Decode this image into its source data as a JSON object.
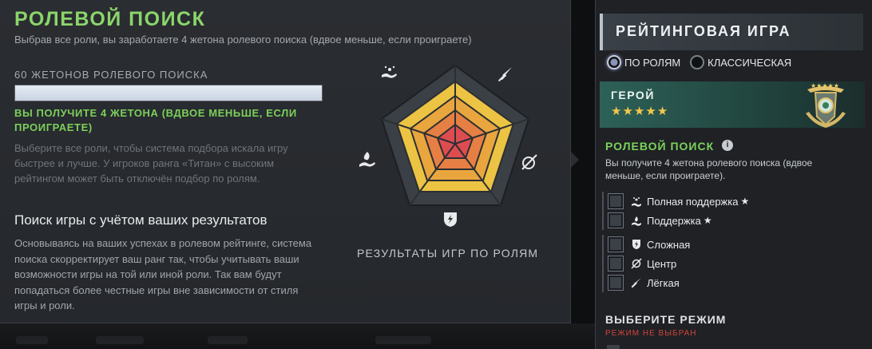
{
  "popup": {
    "title": "РОЛЕВОЙ ПОИСК",
    "subtitle": "Выбрав все роли, вы заработаете 4 жетона ролевого поиска (вдвое меньше, если проиграете)",
    "tokens_label": "60 ЖЕТОНОВ РОЛЕВОГО ПОИСКА",
    "tokens_progress": 1.0,
    "receive_text": "ВЫ ПОЛУЧИТЕ 4 ЖЕТОНА (ВДВОЕ МЕНЬШЕ, ЕСЛИ ПРОИГРАЕТЕ)",
    "hint_text": "Выберите все роли, чтобы система подбора искала игру быстрее и лучше. У игроков ранга «Титан» с высоким рейтингом может быть отключён подбор по ролям.",
    "section_title": "Поиск игры с учётом ваших результатов",
    "section_text": "Основываясь на ваших успехах в ролевом рейтинге, система поиска скорректирует ваш ранг так, чтобы учитывать ваши возможности игры на той или иной роли. Так вам будут попадаться более честные игры вне зависимости от стиля игры и роли.",
    "radar_caption": "РЕЗУЛЬТАТЫ ИГР ПО РОЛЯМ",
    "radar_icons": [
      "hard-support-icon",
      "carry-sword-icon",
      "mid-bow-icon",
      "offlane-shield-icon",
      "support-hand-icon"
    ],
    "colors": {
      "title": "#8bd66b",
      "receive": "#7cd05a"
    }
  },
  "right": {
    "ranked_title": "РЕЙТИНГОВАЯ ИГРА",
    "radio_roles": "ПО РОЛЯМ",
    "radio_classic": "КЛАССИЧЕСКАЯ",
    "hero_label": "ГЕРОЙ",
    "hero_stars": 5,
    "role_search_title": "РОЛЕВОЙ ПОИСК",
    "role_search_text": "Вы получите 4 жетона ролевого поиска (вдвое меньше, если проиграете).",
    "roles_group1": [
      {
        "label": "Полная поддержка",
        "icon": "hard-support-icon"
      },
      {
        "label": "Поддержка",
        "icon": "support-icon"
      }
    ],
    "roles_group2": [
      {
        "label": "Сложная",
        "icon": "offlane-icon"
      },
      {
        "label": "Центр",
        "icon": "mid-icon"
      },
      {
        "label": "Лёгкая",
        "icon": "safelane-icon"
      }
    ],
    "mode_title": "ВЫБЕРИТЕ РЕЖИМ",
    "mode_status": "РЕЖИМ НЕ ВЫБРАН",
    "colors": {
      "accent_green": "#7bd25a",
      "warning": "#d0443a",
      "star": "#f3c74b"
    }
  }
}
